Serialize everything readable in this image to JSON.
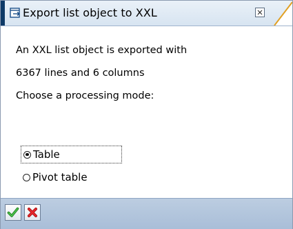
{
  "window": {
    "title": "Export list object to XXL",
    "title_icon": "export-window-icon",
    "close_icon": "close-icon"
  },
  "message": {
    "line1": "An XXL list object is exported with",
    "line2": "6367 lines and 6 columns",
    "line3": "Choose a processing mode:"
  },
  "processing_mode": {
    "options": [
      {
        "label": "Table",
        "selected": true
      },
      {
        "label": "Pivot table",
        "selected": false
      }
    ]
  },
  "footer": {
    "confirm_icon": "checkmark-icon",
    "cancel_icon": "cancel-x-icon"
  },
  "colors": {
    "titlebar_accent": "#0e3a67",
    "footer": "#b3c6dd",
    "confirm_green": "#2e9a2e",
    "cancel_red": "#d6161a"
  }
}
